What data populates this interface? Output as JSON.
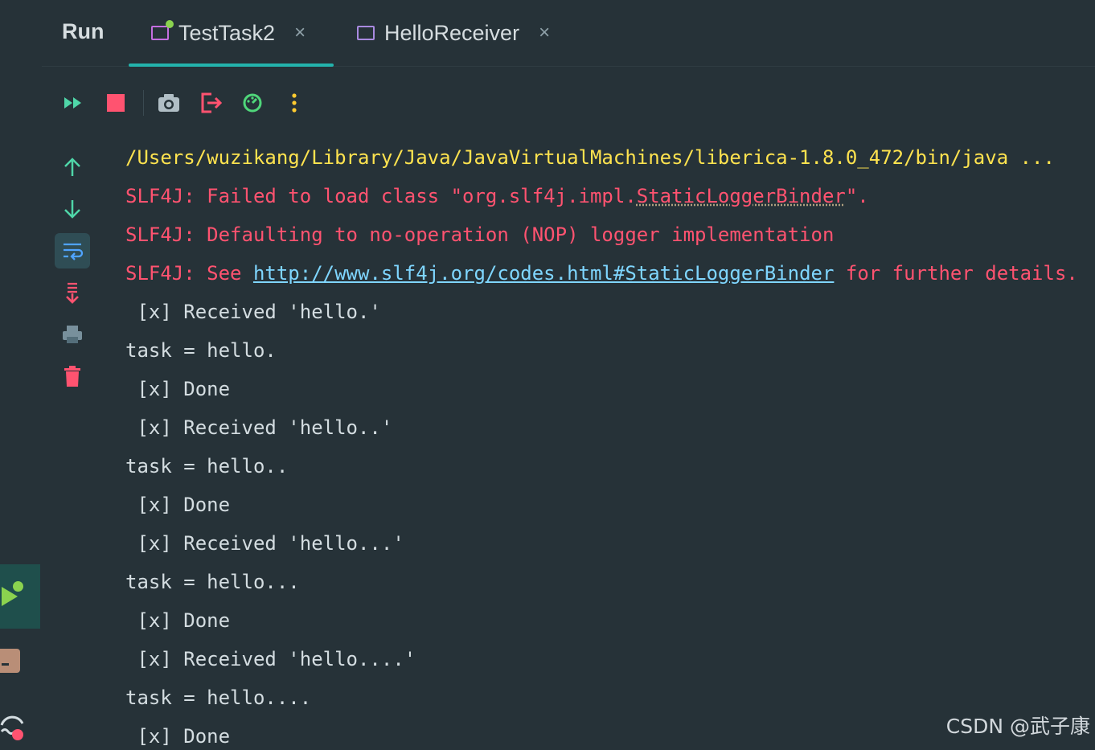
{
  "tabs": {
    "run_label": "Run",
    "items": [
      {
        "label": "TestTask2",
        "close": "×"
      },
      {
        "label": "HelloReceiver",
        "close": "×"
      }
    ]
  },
  "toolbar": {
    "icons": [
      "rerun-icon",
      "stop-icon",
      "screenshot-icon",
      "exit-icon",
      "profiler-icon",
      "more-icon"
    ]
  },
  "side_actions": [
    "up-arrow-icon",
    "down-arrow-icon",
    "soft-wrap-icon",
    "scroll-to-end-icon",
    "print-icon",
    "trash-icon"
  ],
  "console": {
    "cmd": "/Users/wuzikang/Library/Java/JavaVirtualMachines/liberica-1.8.0_472/bin/java ...",
    "slf_1_pre": "SLF4J: Failed to load class \"org.slf4j.impl.",
    "slf_1_class": "StaticLoggerBinder",
    "slf_1_post": "\".",
    "slf_2": "SLF4J: Defaulting to no-operation (NOP) logger implementation",
    "slf_3_pre": "SLF4J: See ",
    "slf_3_link": "http://www.slf4j.org/codes.html#StaticLoggerBinder",
    "slf_3_post": " for further details.",
    "lines": [
      " [x] Received 'hello.'",
      "task = hello.",
      " [x] Done",
      " [x] Received 'hello..'",
      "task = hello..",
      " [x] Done",
      " [x] Received 'hello...'",
      "task = hello...",
      " [x] Done",
      " [x] Received 'hello....'",
      "task = hello....",
      " [x] Done"
    ]
  },
  "watermark": "CSDN @武子康",
  "colors": {
    "background": "#263238",
    "accent": "#23b3ac",
    "command": "#ffe34f",
    "error": "#ff5370",
    "link": "#7fd6ff"
  }
}
